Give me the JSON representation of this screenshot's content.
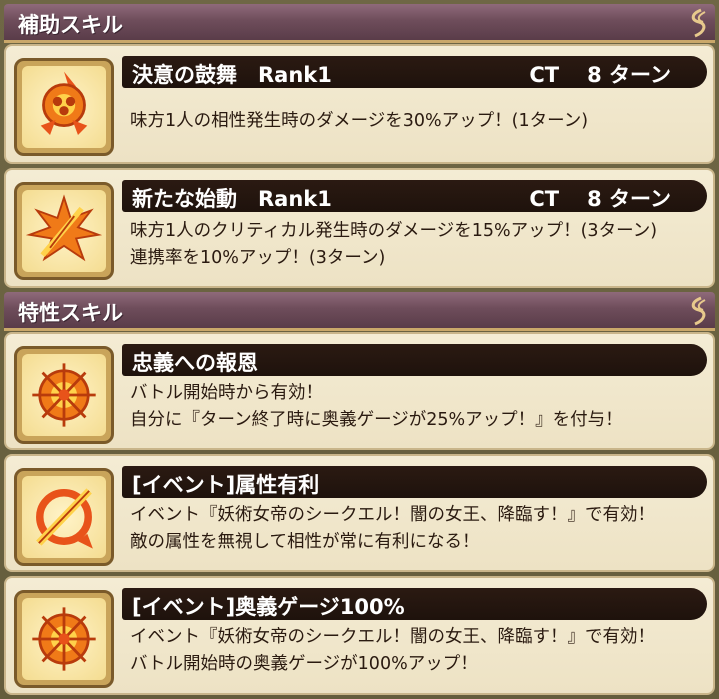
{
  "sections": [
    {
      "title": "補助スキル",
      "skills": [
        {
          "icon": "fist-flame-icon",
          "name": "決意の鼓舞　Rank1",
          "ct_label": "CT",
          "ct_value": "8 ターン",
          "lines": [
            "味方1人の相性発生時のダメージを30%アップ！(1ターン)"
          ]
        },
        {
          "icon": "sword-burst-icon",
          "name": "新たな始動　Rank1",
          "ct_label": "CT",
          "ct_value": "8 ターン",
          "lines": [
            "味方1人のクリティカル発生時のダメージを15%アップ！(3ターン)",
            "連携率を10%アップ！(3ターン)"
          ]
        }
      ]
    },
    {
      "title": "特性スキル",
      "skills": [
        {
          "icon": "fire-sigil-icon",
          "name": "忠義への報恩",
          "lines": [
            "バトル開始時から有効！",
            "自分に『ターン終了時に奥義ゲージが25%アップ！』を付与！"
          ]
        },
        {
          "icon": "flame-slash-icon",
          "name": "[イベント]属性有利",
          "lines": [
            "イベント『妖術女帝のシークエル！闇の女王、降臨す！』で有効！",
            "敵の属性を無視して相性が常に有利になる！"
          ]
        },
        {
          "icon": "fire-sigil-icon",
          "name": "[イベント]奥義ゲージ100%",
          "lines": [
            "イベント『妖術女帝のシークエル！闇の女王、降臨す！』で有効！",
            "バトル開始時の奥義ゲージが100%アップ！"
          ]
        }
      ]
    }
  ],
  "colors": {
    "header_bg": "#6e4d5b",
    "name_bar": "#2b1a12",
    "card_bg": "#f4ecd4",
    "icon_fire": "#e8531a"
  }
}
